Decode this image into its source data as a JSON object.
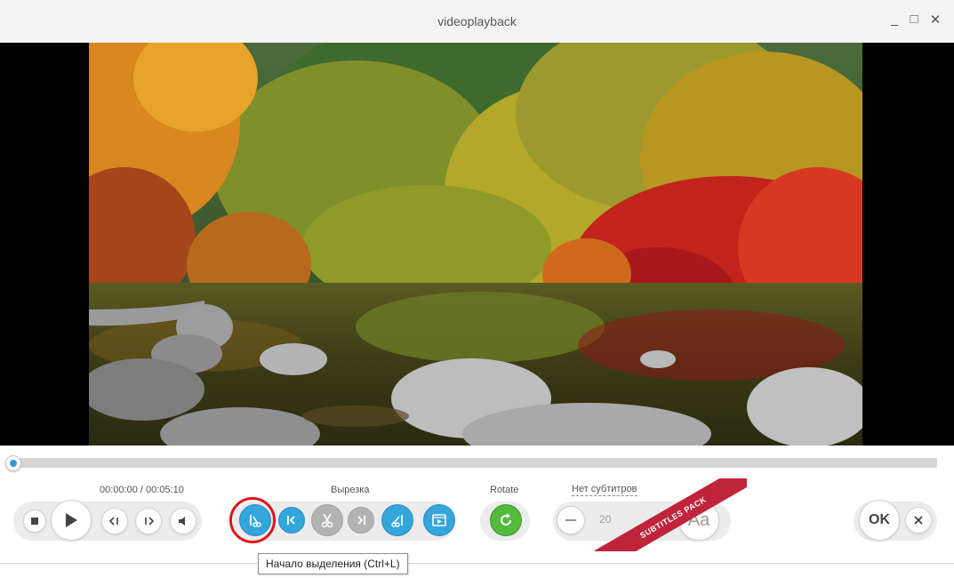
{
  "window": {
    "title": "videoplayback",
    "minimize_glyph": "_",
    "maximize_glyph": "□",
    "close_glyph": "✕"
  },
  "playback": {
    "time_display": "00:00:00 / 00:05:10",
    "progress": 0.0
  },
  "sections": {
    "cut_label": "Вырезка",
    "rotate_label": "Rotate",
    "subtitles_label": "Нет субтитров"
  },
  "subtitles": {
    "size_value": "20",
    "font_button_label": "Aa",
    "promo_ribbon": "SUBTITLES PACK"
  },
  "buttons": {
    "ok_label": "OK"
  },
  "tooltip": {
    "text": "Начало выделения (Ctrl+L)"
  },
  "icons": {
    "stop": "stop-icon",
    "play": "play-icon",
    "prev_frame": "prev-frame-icon",
    "next_frame": "next-frame-icon",
    "volume": "speaker-icon",
    "selection_start": "selection-start-icon",
    "jump_to_start": "jump-to-start-icon",
    "cut": "scissors-icon",
    "jump_to_end": "jump-to-end-icon",
    "selection_end": "selection-end-icon",
    "preview": "film-preview-icon",
    "rotate": "rotate-icon",
    "minus": "minus-icon",
    "close": "close-icon"
  },
  "colors": {
    "accent_blue": "#35a6dc",
    "rotate_green": "#53ba3b",
    "highlight_red": "#e0131b",
    "ribbon_red": "#c0243a"
  }
}
